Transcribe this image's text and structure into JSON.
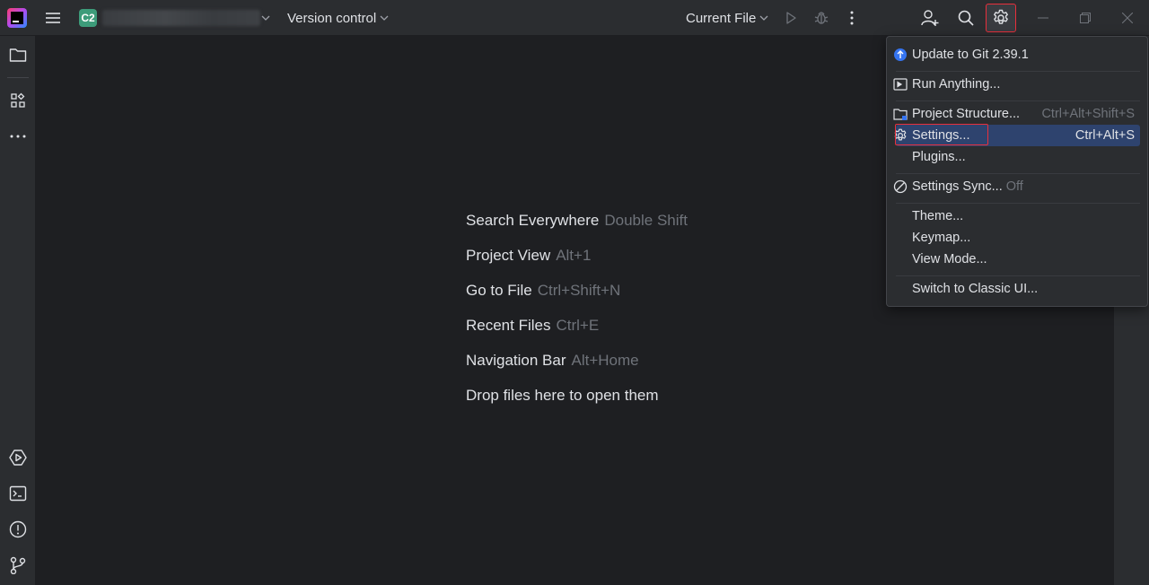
{
  "titlebar": {
    "project_badge": "C2",
    "vcs_label": "Version control",
    "run_config_label": "Current File",
    "icons": [
      "app-logo",
      "hamburger-icon",
      "chevron-down-icon",
      "run-icon",
      "debug-icon",
      "more-vertical-icon",
      "add-user-icon",
      "search-icon",
      "gear-icon",
      "minimize-icon",
      "maximize-icon",
      "close-icon"
    ]
  },
  "left_toolbar": {
    "icons": [
      "folder-icon",
      "structure-icon",
      "more-horizontal-icon",
      "services-icon",
      "terminal-icon",
      "problems-icon",
      "git-branch-icon"
    ]
  },
  "editor": {
    "hints": [
      {
        "label": "Search Everywhere",
        "shortcut": "Double Shift"
      },
      {
        "label": "Project View",
        "shortcut": "Alt+1"
      },
      {
        "label": "Go to File",
        "shortcut": "Ctrl+Shift+N"
      },
      {
        "label": "Recent Files",
        "shortcut": "Ctrl+E"
      },
      {
        "label": "Navigation Bar",
        "shortcut": "Alt+Home"
      },
      {
        "label": "Drop files here to open them",
        "shortcut": ""
      }
    ]
  },
  "menu": {
    "items": [
      {
        "label": "Update to Git 2.39.1",
        "shortcut": "",
        "icon": "update-icon"
      },
      {
        "label": "Run Anything...",
        "shortcut": "",
        "icon": "run-anything-icon"
      },
      {
        "label": "Project Structure...",
        "shortcut": "Ctrl+Alt+Shift+S",
        "icon": "project-structure-icon"
      },
      {
        "label": "Settings...",
        "shortcut": "Ctrl+Alt+S",
        "icon": "gear-icon"
      },
      {
        "label": "Plugins...",
        "shortcut": "",
        "icon": ""
      },
      {
        "label": "Settings Sync...",
        "suffix": "Off",
        "icon": "sync-off-icon"
      },
      {
        "label": "Theme...",
        "shortcut": "",
        "icon": ""
      },
      {
        "label": "Keymap...",
        "shortcut": "",
        "icon": ""
      },
      {
        "label": "View Mode...",
        "shortcut": "",
        "icon": ""
      },
      {
        "label": "Switch to Classic UI...",
        "shortcut": "",
        "icon": ""
      }
    ]
  },
  "colors": {
    "background": "#1e1f22",
    "panel": "#2b2d30",
    "selection": "#2e436e",
    "highlight_border": "#e8303c",
    "accent_blue": "#3574f0",
    "project_badge": "#3d9c7a"
  }
}
